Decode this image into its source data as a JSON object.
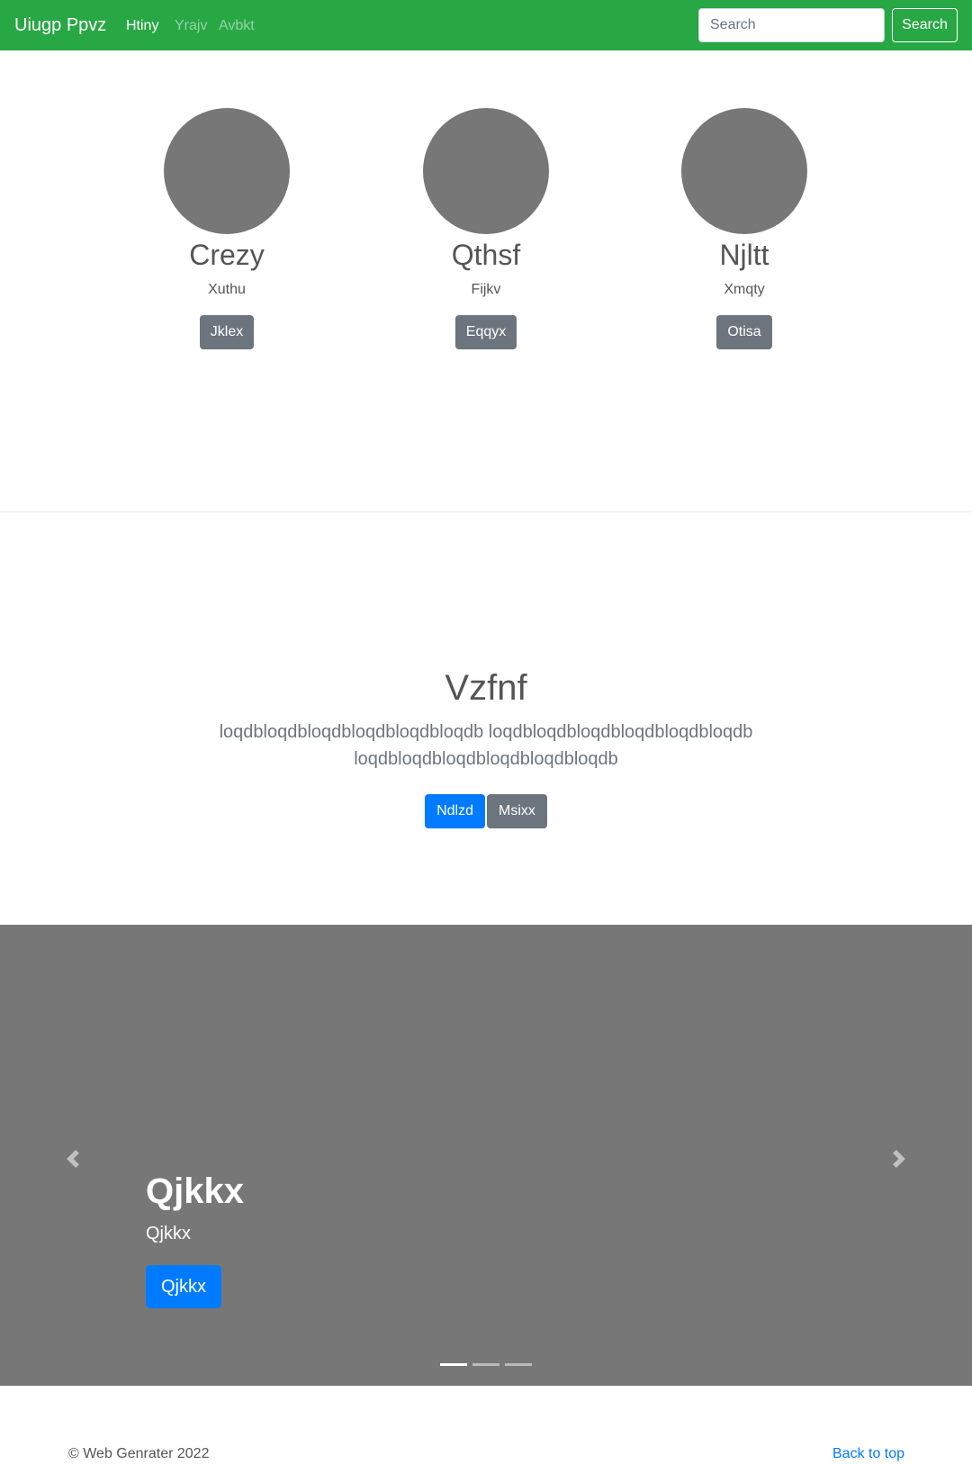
{
  "navbar": {
    "brand": "Uiugp Ppvz",
    "links": [
      {
        "label": "Htiny",
        "active": true
      },
      {
        "label": "Yrajv",
        "active": false
      },
      {
        "label": "Avbkt",
        "active": false
      }
    ],
    "search_placeholder": "Search",
    "search_button": "Search",
    "color": "#28a745"
  },
  "team": [
    {
      "name": "Crezy",
      "role": "Xuthu",
      "button": "Jklex"
    },
    {
      "name": "Qthsf",
      "role": "Fijkv",
      "button": "Eqqyx"
    },
    {
      "name": "Njltt",
      "role": "Xmqty",
      "button": "Otisa"
    }
  ],
  "hero": {
    "title": "Vzfnf",
    "lead": "loqdbloqdbloqdbloqdbloqdbloqdb loqdbloqdbloqdbloqdbloqdbloqdb loqdbloqdbloqdbloqdbloqdbloqdb",
    "primary_button": "Ndlzd",
    "secondary_button": "Msixx"
  },
  "carousel": {
    "prev_icon": "chevron-left-icon",
    "next_icon": "chevron-right-icon",
    "slide": {
      "title": "Qjkkx",
      "text": "Qjkkx",
      "button": "Qjkkx"
    },
    "indicators": 3,
    "active_indicator": 0
  },
  "footer": {
    "copyright": "© Web Genrater 2022",
    "back_to_top": "Back to top"
  }
}
